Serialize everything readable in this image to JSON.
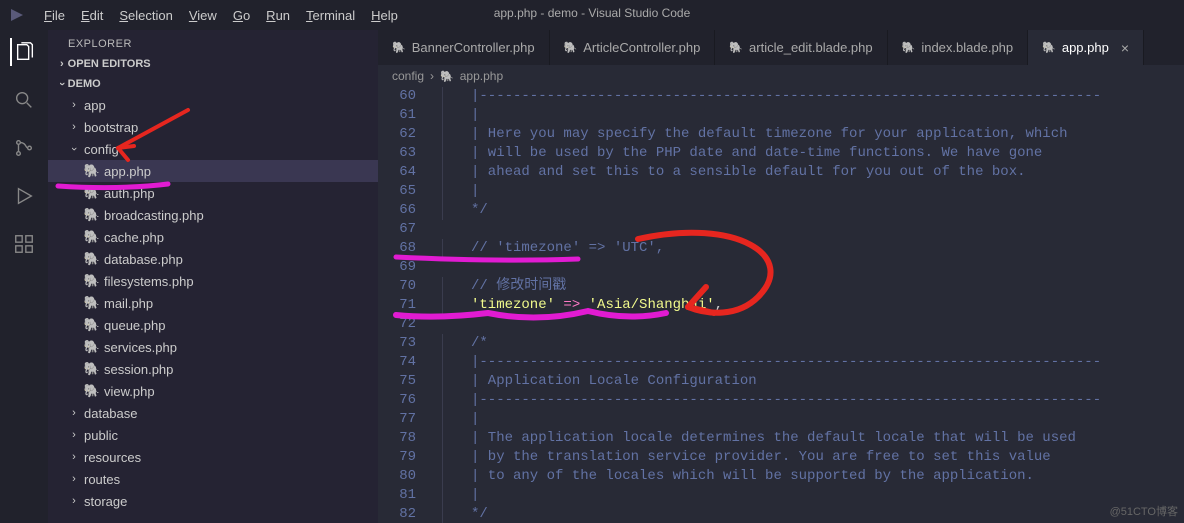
{
  "window": {
    "title": "app.php - demo - Visual Studio Code"
  },
  "menubar": {
    "items": [
      {
        "hot": "F",
        "rest": "ile"
      },
      {
        "hot": "E",
        "rest": "dit"
      },
      {
        "hot": "S",
        "rest": "election"
      },
      {
        "hot": "V",
        "rest": "iew"
      },
      {
        "hot": "G",
        "rest": "o"
      },
      {
        "hot": "R",
        "rest": "un"
      },
      {
        "hot": "T",
        "rest": "erminal"
      },
      {
        "hot": "H",
        "rest": "elp"
      }
    ]
  },
  "sidebar": {
    "title": "EXPLORER",
    "open_editors": "OPEN EDITORS",
    "project": "DEMO",
    "tree": [
      {
        "type": "folder",
        "label": "app",
        "depth": 1,
        "expanded": false
      },
      {
        "type": "folder",
        "label": "bootstrap",
        "depth": 1,
        "expanded": false
      },
      {
        "type": "folder",
        "label": "config",
        "depth": 1,
        "expanded": true
      },
      {
        "type": "php",
        "label": "app.php",
        "depth": 2,
        "selected": true
      },
      {
        "type": "php",
        "label": "auth.php",
        "depth": 2
      },
      {
        "type": "php",
        "label": "broadcasting.php",
        "depth": 2
      },
      {
        "type": "php",
        "label": "cache.php",
        "depth": 2
      },
      {
        "type": "php",
        "label": "database.php",
        "depth": 2
      },
      {
        "type": "php",
        "label": "filesystems.php",
        "depth": 2
      },
      {
        "type": "php",
        "label": "mail.php",
        "depth": 2
      },
      {
        "type": "php",
        "label": "queue.php",
        "depth": 2
      },
      {
        "type": "php",
        "label": "services.php",
        "depth": 2
      },
      {
        "type": "php",
        "label": "session.php",
        "depth": 2
      },
      {
        "type": "php",
        "label": "view.php",
        "depth": 2
      },
      {
        "type": "folder",
        "label": "database",
        "depth": 1,
        "expanded": false
      },
      {
        "type": "folder",
        "label": "public",
        "depth": 1,
        "expanded": false
      },
      {
        "type": "folder",
        "label": "resources",
        "depth": 1,
        "expanded": false
      },
      {
        "type": "folder",
        "label": "routes",
        "depth": 1,
        "expanded": false
      },
      {
        "type": "folder",
        "label": "storage",
        "depth": 1,
        "expanded": false
      }
    ]
  },
  "tabs": [
    {
      "label": "BannerController.php",
      "icon": "php"
    },
    {
      "label": "ArticleController.php",
      "icon": "php"
    },
    {
      "label": "article_edit.blade.php",
      "icon": "php"
    },
    {
      "label": "index.blade.php",
      "icon": "php"
    },
    {
      "label": "app.php",
      "icon": "php",
      "active": true,
      "close": true
    }
  ],
  "breadcrumb": {
    "folder": "config",
    "file": "app.php"
  },
  "code_start_line": 60,
  "code": [
    [
      {
        "t": "|--------------------------------------------------------------------------",
        "c": "comment",
        "ind": 2
      }
    ],
    [
      {
        "t": "|",
        "c": "comment",
        "ind": 2
      }
    ],
    [
      {
        "t": "| Here you may specify the default timezone for your application, which",
        "c": "comment",
        "ind": 2
      }
    ],
    [
      {
        "t": "| will be used by the PHP date and date-time functions. We have gone",
        "c": "comment",
        "ind": 2
      }
    ],
    [
      {
        "t": "| ahead and set this to a sensible default for you out of the box.",
        "c": "comment",
        "ind": 2
      }
    ],
    [
      {
        "t": "|",
        "c": "comment",
        "ind": 2
      }
    ],
    [
      {
        "t": "*/",
        "c": "comment",
        "ind": 2
      }
    ],
    [],
    [
      {
        "t": "// 'timezone' => 'UTC',",
        "c": "comment",
        "ind": 2
      }
    ],
    [],
    [
      {
        "t": "// 修改时间戳",
        "c": "comment",
        "ind": 2
      }
    ],
    [
      {
        "t": "'timezone'",
        "c": "string",
        "ind": 2
      },
      {
        "t": " ",
        "c": "plain"
      },
      {
        "t": "=>",
        "c": "op"
      },
      {
        "t": " ",
        "c": "plain"
      },
      {
        "t": "'Asia/Shanghai'",
        "c": "string"
      },
      {
        "t": ",",
        "c": "plain"
      }
    ],
    [],
    [
      {
        "t": "/*",
        "c": "comment",
        "ind": 2
      }
    ],
    [
      {
        "t": "|--------------------------------------------------------------------------",
        "c": "comment",
        "ind": 2
      }
    ],
    [
      {
        "t": "| Application Locale Configuration",
        "c": "comment",
        "ind": 2
      }
    ],
    [
      {
        "t": "|--------------------------------------------------------------------------",
        "c": "comment",
        "ind": 2
      }
    ],
    [
      {
        "t": "|",
        "c": "comment",
        "ind": 2
      }
    ],
    [
      {
        "t": "| The application locale determines the default locale that will be used",
        "c": "comment",
        "ind": 2
      }
    ],
    [
      {
        "t": "| by the translation service provider. You are free to set this value",
        "c": "comment",
        "ind": 2
      }
    ],
    [
      {
        "t": "| to any of the locales which will be supported by the application.",
        "c": "comment",
        "ind": 2
      }
    ],
    [
      {
        "t": "|",
        "c": "comment",
        "ind": 2
      }
    ],
    [
      {
        "t": "*/",
        "c": "comment",
        "ind": 2
      }
    ]
  ],
  "watermark": "@51CTO博客"
}
